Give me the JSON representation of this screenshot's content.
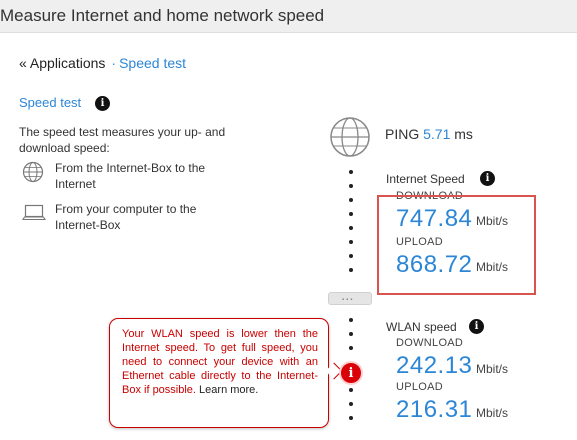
{
  "header": {
    "title": "Measure Internet and home network speed"
  },
  "breadcrumb": {
    "back": "« Applications",
    "separator": "·",
    "current": "Speed test"
  },
  "section": {
    "title": "Speed test",
    "description": "The speed test measures your up- and download speed:",
    "options": [
      {
        "icon": "globe-icon",
        "text": "From the Internet-Box to the Internet"
      },
      {
        "icon": "laptop-icon",
        "text": "From your computer to the Internet-Box"
      }
    ]
  },
  "ping": {
    "label": "PING",
    "value": "5.71",
    "unit": "ms"
  },
  "internet_speed": {
    "title": "Internet Speed",
    "download_label": "DOWNLOAD",
    "download_value": "747.84",
    "download_unit": "Mbit/s",
    "upload_label": "UPLOAD",
    "upload_value": "868.72",
    "upload_unit": "Mbit/s"
  },
  "wlan_speed": {
    "title": "WLAN speed",
    "download_label": "DOWNLOAD",
    "download_value": "242.13",
    "download_unit": "Mbit/s",
    "upload_label": "UPLOAD",
    "upload_value": "216.31",
    "upload_unit": "Mbit/s"
  },
  "tooltip": {
    "text": "Your WLAN speed is lower then the Internet speed. To get full speed, you need to connect your device with an Ethernet cable directly to the Internet-Box if possible.",
    "link": "Learn more."
  },
  "colors": {
    "accent": "#2c86d6",
    "alert": "#c90000",
    "highlight": "#d9534f"
  }
}
